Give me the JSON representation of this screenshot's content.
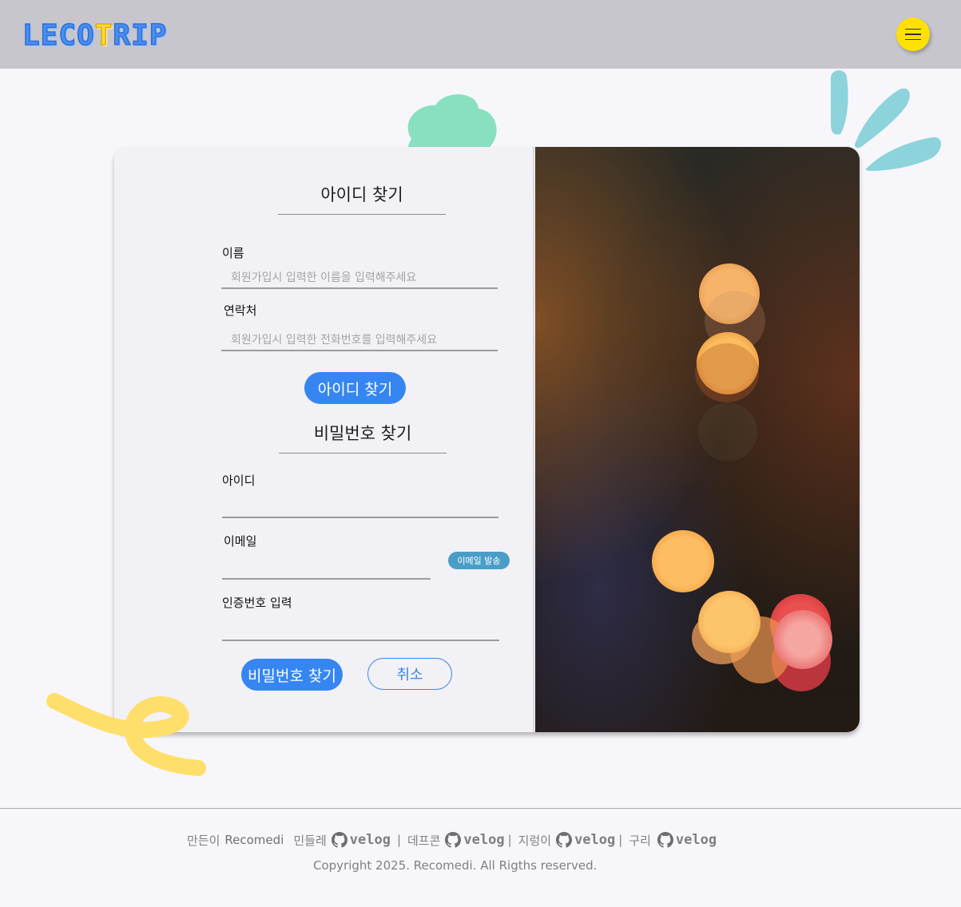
{
  "header": {
    "logo_main": "LECO",
    "logo_accent": "T",
    "logo_end": "RIP",
    "menu_icon": "hamburger-menu-icon",
    "menu_color": "#ffe100",
    "background": "#c7c6cd"
  },
  "find_id": {
    "title": "아이디 찾기",
    "name_label": "이름",
    "name_placeholder": "회원가입시 입력한 이름을 입력해주세요",
    "phone_label": "연락처",
    "phone_placeholder": "회원가입시 입력한 전화번호를 입력해주세요",
    "submit_label": "아이디 찾기"
  },
  "find_password": {
    "title": "비밀번호 찾기",
    "id_label": "아이디",
    "email_label": "이메일",
    "send_email_label": "이메일 발송",
    "code_label": "인증번호 입력",
    "submit_label": "비밀번호 찾기",
    "cancel_label": "취소"
  },
  "footer": {
    "made_by": "만든이",
    "brand": "Recomedi",
    "members": [
      {
        "name": "민들레",
        "link_icon": "github-icon",
        "link_text": "velog"
      },
      {
        "name": "데프콘",
        "link_icon": "github-icon",
        "link_text": "velog"
      },
      {
        "name": "지렁이",
        "link_icon": "github-icon",
        "link_text": "velog"
      },
      {
        "name": "구리",
        "link_icon": "github-icon",
        "link_text": "velog"
      }
    ],
    "separator": "|",
    "copyright": "Copyright 2025. Recomedi. All Rigths reserved."
  },
  "colors": {
    "primary": "#3686f2",
    "email_button": "#4a9dc7",
    "mint_blob": "#88e0c1",
    "teal_leaves": "#8dd3dc",
    "yellow_squiggle": "#ffdf6b"
  }
}
